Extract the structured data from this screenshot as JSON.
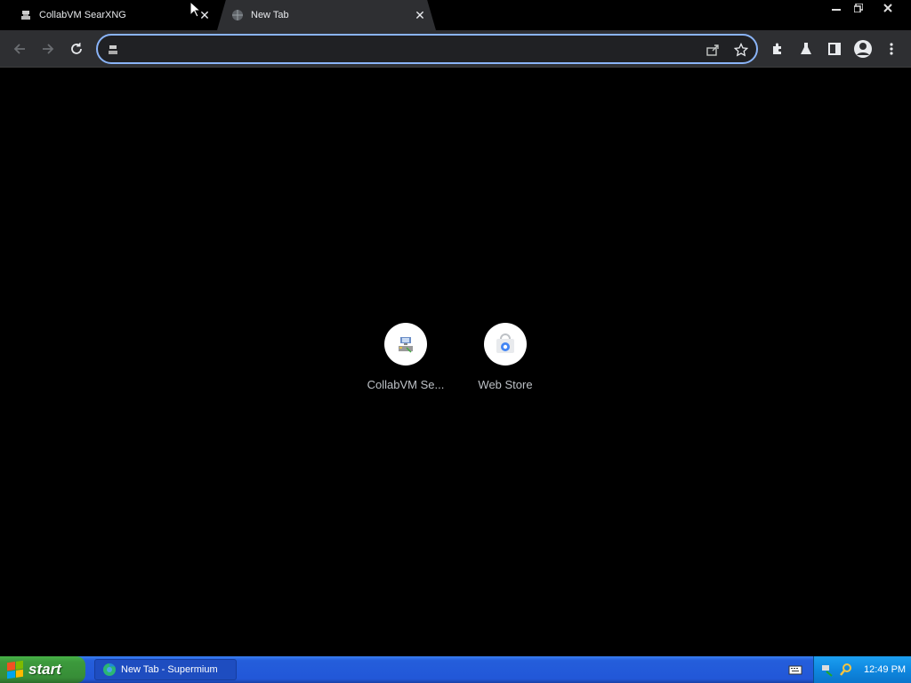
{
  "browser": {
    "tabs": [
      {
        "title": "CollabVM SearXNG",
        "close": "✕"
      },
      {
        "title": "New Tab",
        "close": "✕"
      }
    ],
    "window_controls": {
      "minimize": "minimize",
      "restore": "restore",
      "close": "close"
    },
    "omnibox": {
      "value": "",
      "placeholder": ""
    }
  },
  "shortcuts": [
    {
      "label": "CollabVM Se...",
      "icon": "collabvm-icon"
    },
    {
      "label": "Web Store",
      "icon": "web-store-icon"
    }
  ],
  "taskbar": {
    "start_label": "start",
    "task_item": "New Tab - Supermium",
    "clock": "12:49 PM"
  },
  "colors": {
    "accent": "#8ab4f8",
    "taskbar": "#245edb",
    "start": "#3c9a3c",
    "tray": "#0f88e0"
  }
}
